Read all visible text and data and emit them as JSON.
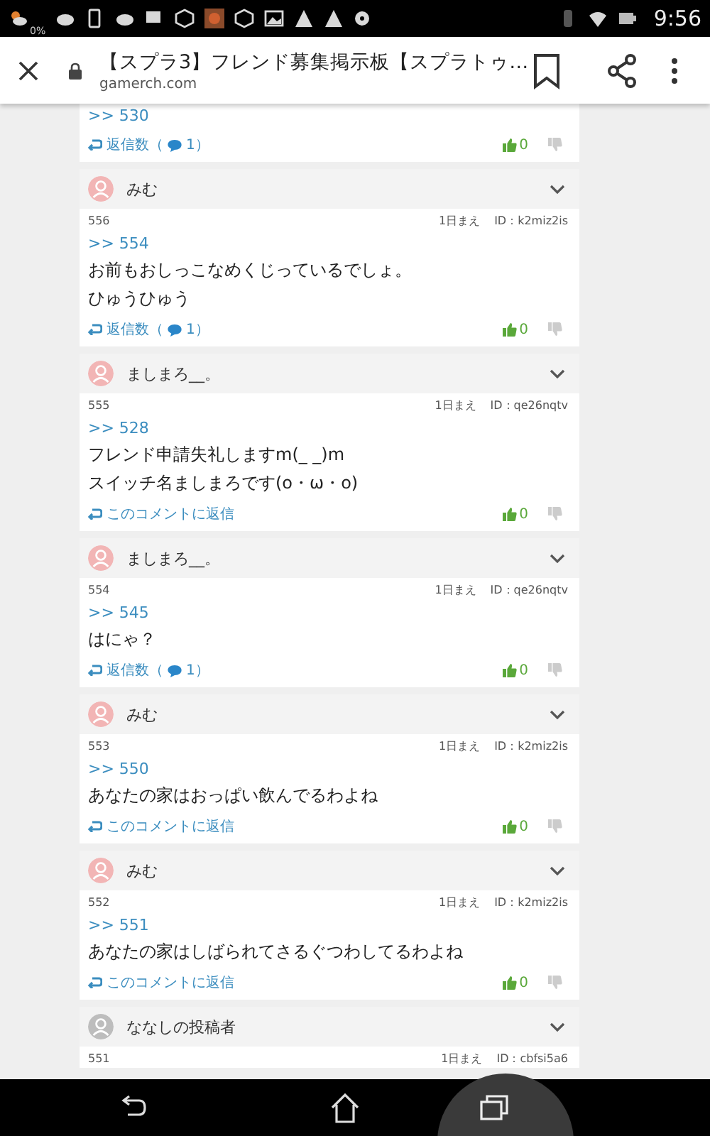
{
  "status_bar": {
    "battery_text": "0%",
    "time": "9:56"
  },
  "toolbar": {
    "title": "【スプラ3】フレンド募集掲示板【スプラトゥ…",
    "url": "gamerch.com"
  },
  "comments": [
    {
      "kind": "partial",
      "ref": ">> 530",
      "reply": {
        "kind": "count",
        "label": "返信数（",
        "count": "1）"
      },
      "likes": "0"
    },
    {
      "kind": "full",
      "author": "みむ",
      "color": "#f2b5b5",
      "number": "556",
      "time": "1日まえ",
      "id": "ID：k2miz2is",
      "ref": ">> 554",
      "lines": [
        "お前もおしっこなめくじっているでしょ。",
        "ひゅうひゅう"
      ],
      "reply": {
        "kind": "count",
        "label": "返信数（",
        "count": "1）"
      },
      "likes": "0"
    },
    {
      "kind": "full",
      "author": "ましまろ__。",
      "color": "#f2b5b5",
      "number": "555",
      "time": "1日まえ",
      "id": "ID：qe26nqtv",
      "ref": ">> 528",
      "lines": [
        "フレンド申請失礼しますm(_ _)m",
        "スイッチ名ましまろです(o・ω・o)"
      ],
      "reply": {
        "kind": "link",
        "label": "このコメントに返信"
      },
      "likes": "0"
    },
    {
      "kind": "full",
      "author": "ましまろ__。",
      "color": "#f2b5b5",
      "number": "554",
      "time": "1日まえ",
      "id": "ID：qe26nqtv",
      "ref": ">> 545",
      "lines": [
        "はにゃ？"
      ],
      "reply": {
        "kind": "count",
        "label": "返信数（",
        "count": "1）"
      },
      "likes": "0"
    },
    {
      "kind": "full",
      "author": "みむ",
      "color": "#f2b5b5",
      "number": "553",
      "time": "1日まえ",
      "id": "ID：k2miz2is",
      "ref": ">> 550",
      "lines": [
        "あなたの家はおっぱい飲んでるわよね"
      ],
      "reply": {
        "kind": "link",
        "label": "このコメントに返信"
      },
      "likes": "0"
    },
    {
      "kind": "full",
      "author": "みむ",
      "color": "#f2b5b5",
      "number": "552",
      "time": "1日まえ",
      "id": "ID：k2miz2is",
      "ref": ">> 551",
      "lines": [
        "あなたの家はしばられてさるぐつわしてるわよね"
      ],
      "reply": {
        "kind": "link",
        "label": "このコメントに返信"
      },
      "likes": "0"
    },
    {
      "kind": "cut",
      "author": "ななしの投稿者",
      "color": "#bdbdbd",
      "number": "551",
      "time": "1日まえ",
      "id": "ID：cbfsi5a6"
    }
  ]
}
